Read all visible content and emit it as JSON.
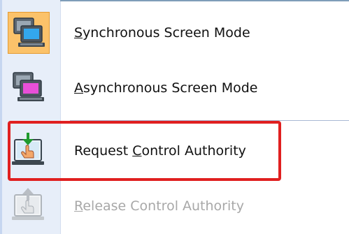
{
  "menu": {
    "items": [
      {
        "pre": "",
        "mnemonic": "S",
        "post": "ynchronous Screen Mode",
        "icon": "dual-monitor-blue-icon",
        "selected": true,
        "enabled": true
      },
      {
        "pre": "",
        "mnemonic": "A",
        "post": "synchronous Screen Mode",
        "icon": "dual-monitor-pink-icon",
        "selected": false,
        "enabled": true
      },
      {
        "pre": "Request ",
        "mnemonic": "C",
        "post": "ontrol Authority",
        "icon": "request-control-icon",
        "selected": false,
        "enabled": true
      },
      {
        "pre": "",
        "mnemonic": "R",
        "post": "elease Control Authority",
        "icon": "release-control-icon",
        "selected": false,
        "enabled": false
      }
    ]
  },
  "colors": {
    "selected_background": "#fbc26a",
    "highlight_border": "#e02020",
    "gutter": "#e7eef9",
    "disabled_text": "#a8a8a8"
  }
}
